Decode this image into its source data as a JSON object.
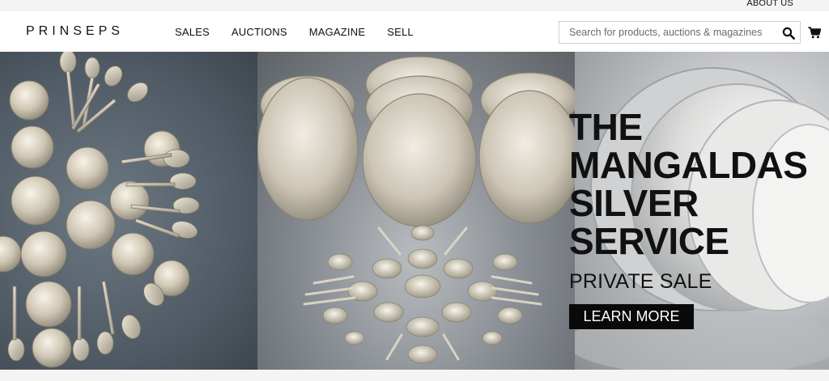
{
  "topbar": {
    "about_label": "ABOUT US"
  },
  "header": {
    "logo": "PRINSEPS",
    "nav": [
      "SALES",
      "AUCTIONS",
      "MAGAZINE",
      "SELL"
    ],
    "search_placeholder": "Search for products, auctions & magazines",
    "icons": {
      "search": "search-icon",
      "cart": "cart-icon"
    }
  },
  "hero": {
    "title_lines": [
      "THE",
      "MANGALDAS",
      "SILVER",
      "SERVICE"
    ],
    "subtitle": "PRIVATE SALE",
    "cta_label": "LEARN MORE"
  }
}
